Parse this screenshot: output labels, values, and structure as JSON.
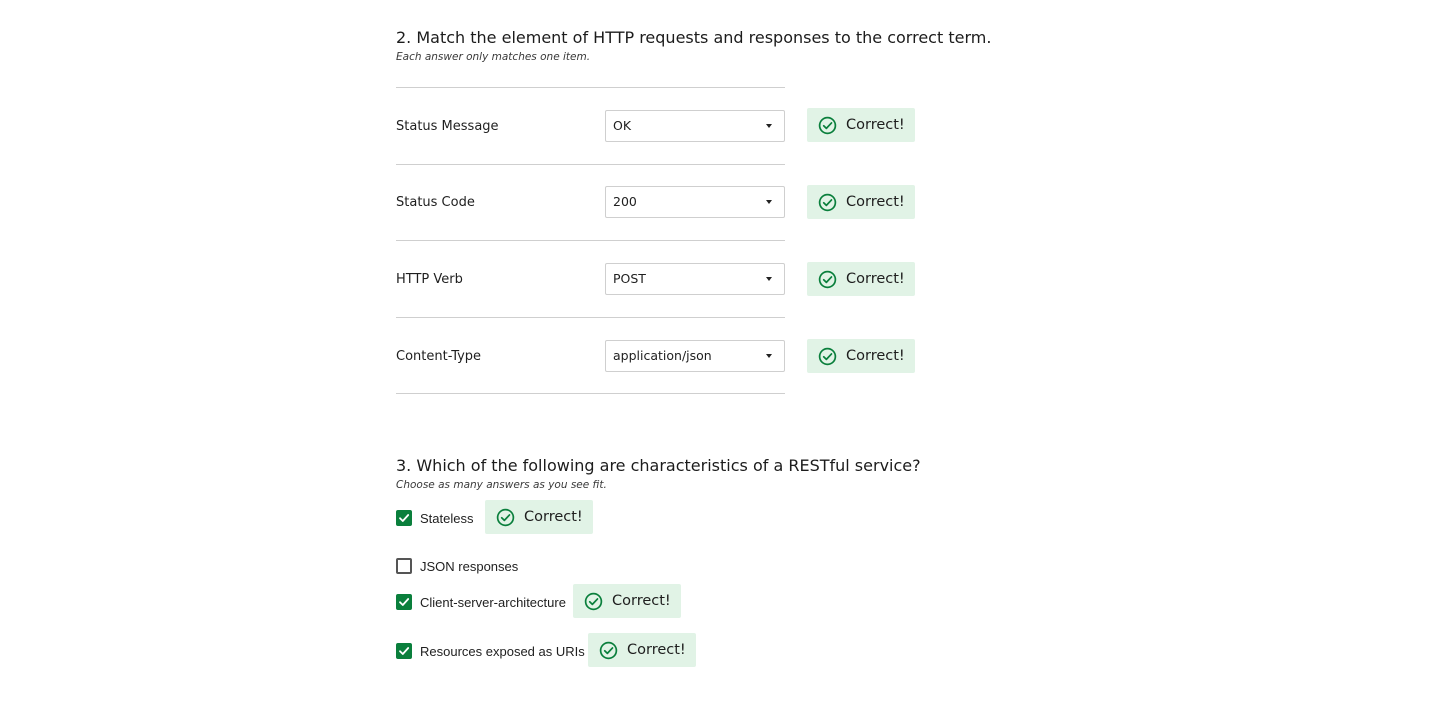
{
  "q2": {
    "title": "2. Match the element of HTTP requests and responses to the correct term.",
    "subtitle": "Each answer only matches one item.",
    "rows": [
      {
        "term": "Status Message",
        "selected": "OK",
        "feedback": "Correct!"
      },
      {
        "term": "Status Code",
        "selected": "200",
        "feedback": "Correct!"
      },
      {
        "term": "HTTP Verb",
        "selected": "POST",
        "feedback": "Correct!"
      },
      {
        "term": "Content-Type",
        "selected": "application/json",
        "feedback": "Correct!"
      }
    ]
  },
  "q3": {
    "title": "3. Which of the following are characteristics of a RESTful service?",
    "subtitle": "Choose as many answers as you see fit.",
    "options": [
      {
        "label": "Stateless",
        "checked": true,
        "feedback": "Correct!"
      },
      {
        "label": "JSON responses",
        "checked": false,
        "feedback": ""
      },
      {
        "label": "Client-server-architecture",
        "checked": true,
        "feedback": "Correct!"
      },
      {
        "label": "Resources exposed as URIs",
        "checked": true,
        "feedback": "Correct!"
      }
    ]
  },
  "icons": {
    "correct": "check-circle-icon",
    "dropdown": "caret-down-icon",
    "checkbox_checked": "checkmark-icon"
  },
  "colors": {
    "correct_bg": "#e1f3e6",
    "correct_icon": "#0a7f3c",
    "checkbox_checked": "#0a7f3c"
  }
}
